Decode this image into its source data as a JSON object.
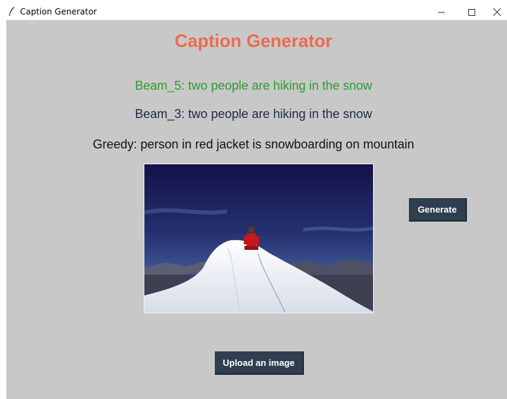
{
  "window": {
    "title": "Caption Generator",
    "icon": "feather-icon",
    "controls": [
      "minimize-icon",
      "maximize-icon",
      "close-icon"
    ]
  },
  "app": {
    "heading": "Caption Generator",
    "heading_color": "#f0694f"
  },
  "captions": {
    "beam5": "Beam_5: two people are hiking in the snow",
    "beam3": "Beam_3: two people are hiking in the snow",
    "greedy": "Greedy: person in red jacket is snowboarding on mountain"
  },
  "buttons": {
    "generate": "Generate",
    "upload": "Upload an image",
    "color": "#2f3f4f"
  },
  "colors": {
    "background": "#c8c8c8",
    "beam5": "#2f9a2f",
    "beam3": "#1d2a46",
    "greedy": "#111111"
  }
}
